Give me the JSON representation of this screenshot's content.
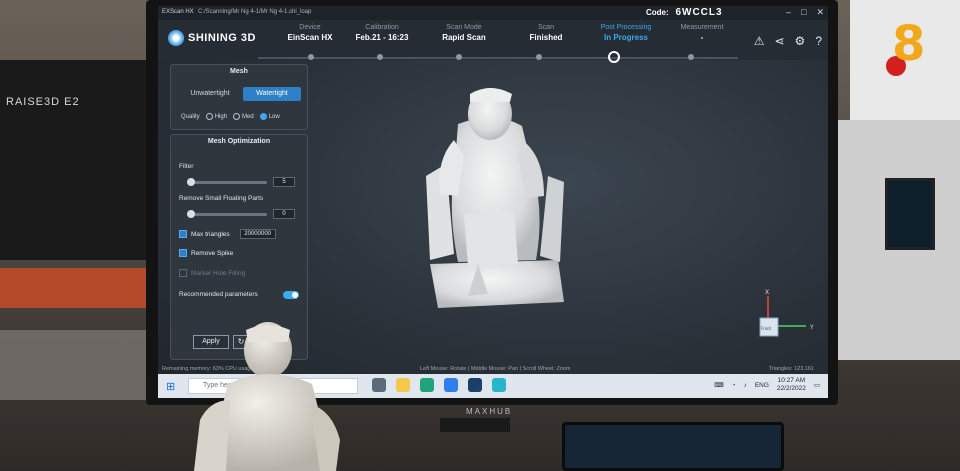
{
  "background": {
    "printer_label": "RAISE3D E2",
    "channel_logo_number": "8",
    "monitor_brand": "MAXHUB"
  },
  "window": {
    "app_name": "EXScan HX",
    "path": "C:/Scanning/Mr Ng 4-1/Mr Ng 4-1.shi_loap",
    "code_label": "Code:",
    "code_value": "6WCCL3",
    "controls": [
      "–",
      "□",
      "✕"
    ]
  },
  "header": {
    "brand": "SHINING 3D",
    "steps": [
      {
        "title": "Device",
        "value": "EinScan HX",
        "state": "done"
      },
      {
        "title": "Calibration",
        "value": "Feb.21 - 16:23",
        "state": "done"
      },
      {
        "title": "Scan Mode",
        "value": "Rapid Scan",
        "state": "done"
      },
      {
        "title": "Scan",
        "value": "Finished",
        "state": "done"
      },
      {
        "title": "Post Processing",
        "value": "In Progress",
        "state": "active"
      },
      {
        "title": "Measurement",
        "value": "-",
        "state": "todo"
      }
    ],
    "icons": [
      "user-alert-icon",
      "share-icon",
      "gear-icon",
      "help-icon"
    ]
  },
  "mesh_panel": {
    "title": "Mesh",
    "options": [
      {
        "label": "Unwatertight",
        "selected": false
      },
      {
        "label": "Watertight",
        "selected": true
      }
    ],
    "quality_label": "Quality",
    "quality_options": [
      {
        "label": "High",
        "selected": false
      },
      {
        "label": "Med",
        "selected": false
      },
      {
        "label": "Low",
        "selected": true
      }
    ]
  },
  "optimization_panel": {
    "title": "Mesh Optimization",
    "filter_label": "Filter",
    "filter_value": "5",
    "floating_label": "Remove Small Floating Parts",
    "floating_value": "0",
    "max_triangles_label": "Max triangles",
    "max_triangles_value": "20000000",
    "remove_spike_label": "Remove Spike",
    "marker_hole_label": "Marker Hole Filling",
    "recommended_label": "Recommended parameters",
    "apply_label": "Apply",
    "reset_icon": "↻"
  },
  "viewport": {
    "hint": "Left Mouse: Rotate | Middle Mouse: Pan | Scroll Wheel: Zoom",
    "status": "Remaining memory: 63% CPU usage: 23%",
    "triangles": "Triangles: 123,161",
    "axis_x": "X",
    "axis_y": "Y",
    "axis_label": "Front"
  },
  "taskbar": {
    "search_placeholder": "Type here to search",
    "lang": "ENG",
    "time": "10:27 AM",
    "date": "22/2/2022"
  },
  "colors": {
    "accent": "#3aa9f0",
    "panel": "#2f363e",
    "viewport_bg": "#2a3038"
  }
}
